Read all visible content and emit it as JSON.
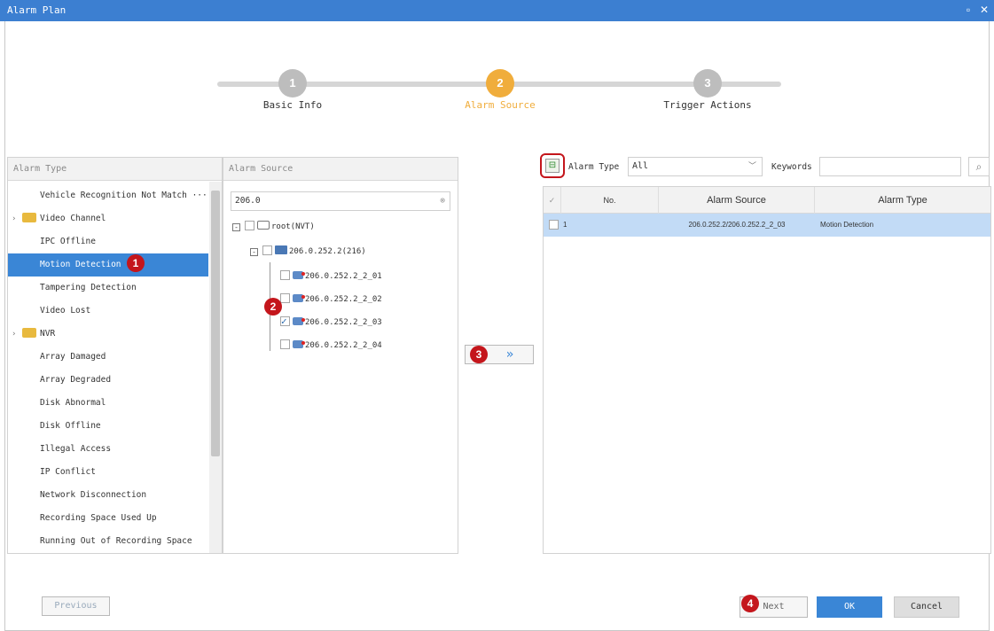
{
  "window": {
    "title": "Alarm Plan",
    "minimize_glyph": "▫",
    "close_glyph": "✕"
  },
  "steps": [
    {
      "number": "1",
      "label": "Basic Info"
    },
    {
      "number": "2",
      "label": "Alarm Source"
    },
    {
      "number": "3",
      "label": "Trigger Actions"
    }
  ],
  "left_panel": {
    "header": "Alarm Type",
    "items": [
      {
        "label": "Vehicle Recognition Not Match ···"
      },
      {
        "label": "Video Channel"
      },
      {
        "label": "IPC Offline"
      },
      {
        "label": "Motion Detection"
      },
      {
        "label": "Tampering Detection"
      },
      {
        "label": "Video Lost"
      },
      {
        "label": "NVR"
      },
      {
        "label": "Array Damaged"
      },
      {
        "label": "Array Degraded"
      },
      {
        "label": "Disk Abnormal"
      },
      {
        "label": "Disk Offline"
      },
      {
        "label": "Illegal Access"
      },
      {
        "label": "IP Conflict"
      },
      {
        "label": "Network Disconnection"
      },
      {
        "label": "Recording Space Used Up"
      },
      {
        "label": "Running Out of Recording Space"
      }
    ]
  },
  "middle_panel": {
    "header": "Alarm Source",
    "search_value": "206.0",
    "tree": [
      {
        "label": "root(NVT)"
      },
      {
        "label": "206.0.252.2(216)"
      },
      {
        "label": "206.0.252.2_2_01"
      },
      {
        "label": "206.0.252.2_2_02"
      },
      {
        "label": "206.0.252.2_2_03"
      },
      {
        "label": "206.0.252.2_2_04"
      }
    ]
  },
  "transfer_button": {
    "label": "»"
  },
  "right_panel": {
    "filter": {
      "type_label": "Alarm Type",
      "type_value": "All",
      "keywords_label": "Keywords",
      "keywords_value": ""
    },
    "table": {
      "headers": {
        "check": "✓",
        "no": "No.",
        "source": "Alarm Source",
        "type": "Alarm Type"
      },
      "rows": [
        {
          "no": "1",
          "source": "206.0.252.2/206.0.252.2_2_03",
          "type": "Motion Detection"
        }
      ]
    }
  },
  "badges": [
    "1",
    "2",
    "3",
    "4"
  ],
  "footer": {
    "previous": "Previous",
    "next": "Next",
    "ok": "OK",
    "cancel": "Cancel"
  },
  "colors": {
    "accent": "#3a86d6",
    "titlebar": "#3c7fd1",
    "step_done": "#bdbdbd",
    "step_active": "#f0ad3c",
    "badge": "#c4161c"
  }
}
